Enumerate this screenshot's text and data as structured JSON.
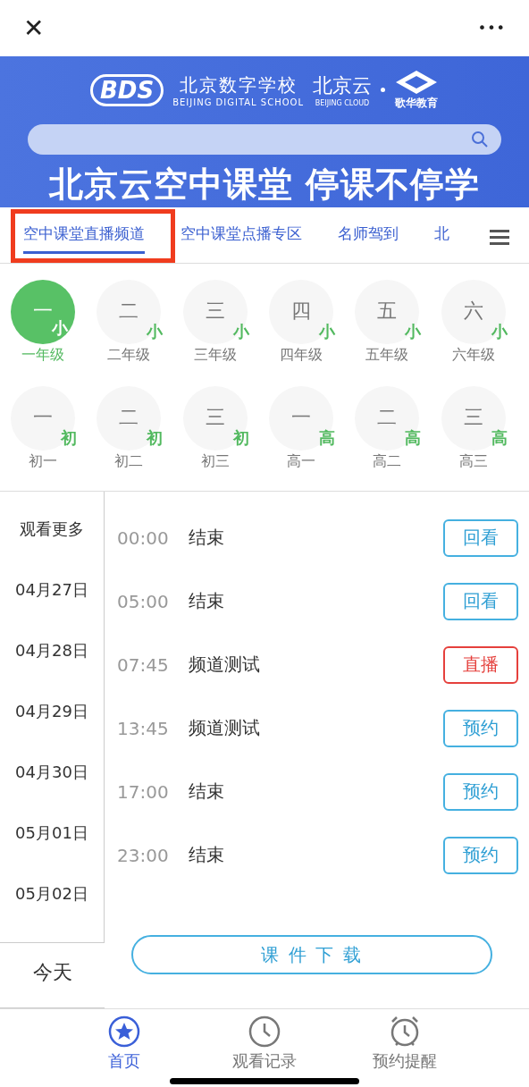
{
  "top_bar": {
    "close": "✕",
    "more": "•••"
  },
  "banner": {
    "logo_mark": "BDS",
    "school_name": "北京数字学校",
    "school_name_en": "BEIJING DIGITAL SCHOOL",
    "cloud_name": "北京云",
    "cloud_name_en": "BEIJING CLOUD",
    "partner_name": "歌华教育",
    "headline": "北京云空中课堂 停课不停学"
  },
  "tabs": [
    {
      "label": "空中课堂直播频道",
      "selected": true
    },
    {
      "label": "空中课堂点播专区",
      "selected": false
    },
    {
      "label": "名师驾到",
      "selected": false
    },
    {
      "label": "北",
      "selected": false
    }
  ],
  "grades": [
    {
      "glyph": "一",
      "suffix": "小",
      "caption": "一年级",
      "selected": true
    },
    {
      "glyph": "二",
      "suffix": "小",
      "caption": "二年级",
      "selected": false
    },
    {
      "glyph": "三",
      "suffix": "小",
      "caption": "三年级",
      "selected": false
    },
    {
      "glyph": "四",
      "suffix": "小",
      "caption": "四年级",
      "selected": false
    },
    {
      "glyph": "五",
      "suffix": "小",
      "caption": "五年级",
      "selected": false
    },
    {
      "glyph": "六",
      "suffix": "小",
      "caption": "六年级",
      "selected": false
    },
    {
      "glyph": "一",
      "suffix": "初",
      "caption": "初一",
      "selected": false
    },
    {
      "glyph": "二",
      "suffix": "初",
      "caption": "初二",
      "selected": false
    },
    {
      "glyph": "三",
      "suffix": "初",
      "caption": "初三",
      "selected": false
    },
    {
      "glyph": "一",
      "suffix": "高",
      "caption": "高一",
      "selected": false
    },
    {
      "glyph": "二",
      "suffix": "高",
      "caption": "高二",
      "selected": false
    },
    {
      "glyph": "三",
      "suffix": "高",
      "caption": "高三",
      "selected": false
    }
  ],
  "dates": [
    "观看更多",
    "04月27日",
    "04月28日",
    "04月29日",
    "04月30日",
    "05月01日",
    "05月02日"
  ],
  "today": "今天",
  "schedule": [
    {
      "time": "00:00",
      "title": "结束",
      "action": "回看",
      "kind": "replay"
    },
    {
      "time": "05:00",
      "title": "结束",
      "action": "回看",
      "kind": "replay"
    },
    {
      "time": "07:45",
      "title": "频道测试",
      "action": "直播",
      "kind": "live"
    },
    {
      "time": "13:45",
      "title": "频道测试",
      "action": "预约",
      "kind": "reserve"
    },
    {
      "time": "17:00",
      "title": "结束",
      "action": "预约",
      "kind": "reserve"
    },
    {
      "time": "23:00",
      "title": "结束",
      "action": "预约",
      "kind": "reserve"
    }
  ],
  "download_button": "课 件 下 载",
  "bottom_nav": [
    {
      "label": "首页",
      "selected": true
    },
    {
      "label": "观看记录",
      "selected": false
    },
    {
      "label": "预约提醒",
      "selected": false
    }
  ]
}
